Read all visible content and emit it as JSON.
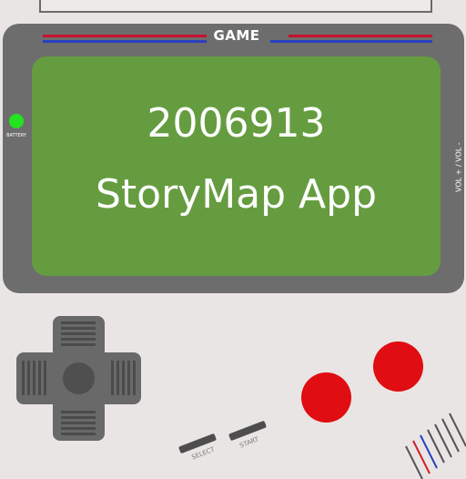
{
  "console": {
    "header_label": "GAME",
    "screen": {
      "line1": "2006913",
      "line2": "StoryMap App"
    },
    "battery_label": "BATTERY",
    "volume_label": "VOL + / VOL -",
    "select_label": "SELECT",
    "start_label": "START"
  },
  "colors": {
    "bezel": "#6d6d6d",
    "screen": "#669c40",
    "stripe_red": "#c8102e",
    "stripe_blue": "#2a3fbf",
    "led": "#22e41f",
    "action_button": "#e00d12",
    "body": "#e9e5e4"
  }
}
